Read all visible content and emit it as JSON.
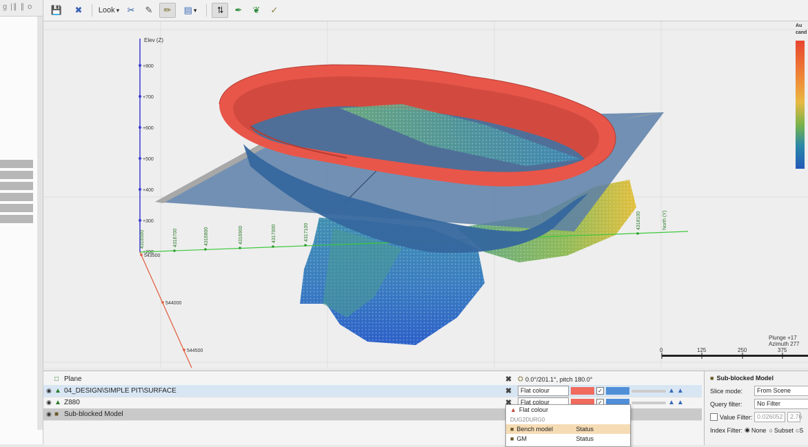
{
  "left_panel": {
    "header": "g |∥ ∥ o"
  },
  "toolbar": {
    "look_label": "Look",
    "look_arrow": "▾",
    "view_arrow": "▾"
  },
  "axes": {
    "elev_label": "Elev (Z)",
    "elev_ticks": [
      "+800",
      "+700",
      "+600",
      "+500",
      "+400",
      "+300",
      "+200"
    ],
    "east_ticks": [
      "543500",
      "544000",
      "544500"
    ],
    "north_ticks": [
      "4316500",
      "4316700",
      "4316800",
      "4316900",
      "4317000",
      "4317100",
      "4318100"
    ],
    "north_label": "North (Y)"
  },
  "orientation": {
    "plunge": "Plunge +17",
    "azimuth": "Azimuth 277"
  },
  "scale_bar": {
    "ticks": [
      "0",
      "125",
      "250",
      "375"
    ]
  },
  "legend": {
    "line1": "Au",
    "line2": "cand"
  },
  "colors": {
    "pit": "#e8564a",
    "pit_inner": "#35679e",
    "plane": "#5c7fa8",
    "legend_top": "#e8452f",
    "legend_bottom": "#2259b8"
  },
  "objects": [
    {
      "name": "Plane",
      "icon": "plane-icon",
      "extra": "0.0°/201.1°, pitch 180.0°"
    },
    {
      "name": "04_DESIGN\\SIMPLE PIT\\SURFACE",
      "icon": "surface-icon",
      "colour_mode": "Flat colour"
    },
    {
      "name": "Z880",
      "icon": "surface-icon",
      "colour_mode": "Flat colour"
    },
    {
      "name": "Sub-blocked Model",
      "icon": "block-model-icon"
    }
  ],
  "dropdown": {
    "header": "Flat colour",
    "sub": "DUG2DURG0",
    "items": [
      {
        "label": "Bench model",
        "status": "Status"
      },
      {
        "label": "GM",
        "status": "Status"
      }
    ]
  },
  "properties": {
    "title": "Sub-blocked Model",
    "slice_mode_label": "Slice mode:",
    "slice_mode_value": "From Scene",
    "query_filter_label": "Query filter:",
    "query_filter_value": "No Filter",
    "value_filter_label": "Value Filter:",
    "value_filter_value": "0.026052",
    "value_filter_value2": "2.76",
    "index_filter_label": "Index Filter:",
    "index_none": "None",
    "index_subset": "Subset",
    "index_s": "S"
  }
}
